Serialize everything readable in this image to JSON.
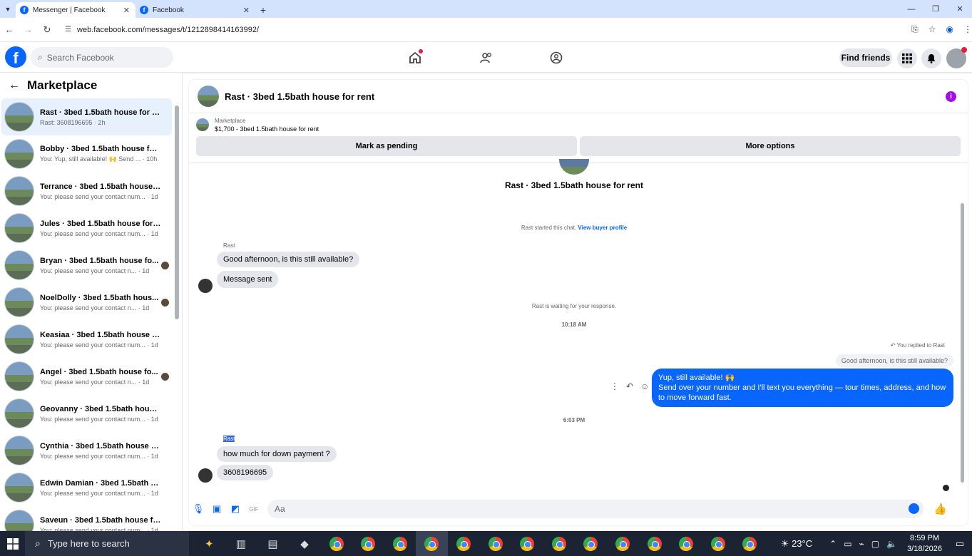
{
  "browser": {
    "tabs": [
      {
        "title": "Messenger | Facebook",
        "active": true
      },
      {
        "title": "Facebook",
        "active": false
      }
    ],
    "url": "web.facebook.com/messages/t/1212898414163992/"
  },
  "fb": {
    "search_placeholder": "Search Facebook",
    "find_friends": "Find friends"
  },
  "sidebar": {
    "title": "Marketplace",
    "conversations": [
      {
        "name": "Rast · 3bed 1.5bath house for rent",
        "preview": "Rast: 3608196695 · 2h",
        "active": true
      },
      {
        "name": "Bobby · 3bed 1.5bath house for ...",
        "preview": "You: Yup, still available! 🙌 Send ... · 10h"
      },
      {
        "name": "Terrance · 3bed 1.5bath house fo...",
        "preview": "You: please send your contact num... · 1d"
      },
      {
        "name": "Jules · 3bed 1.5bath house for rent",
        "preview": "You: please send your contact num... · 1d"
      },
      {
        "name": "Bryan · 3bed 1.5bath house fo...",
        "preview": "You: please send your contact n... · 1d"
      },
      {
        "name": "NoelDolly · 3bed 1.5bath hous...",
        "preview": "You: please send your contact n... · 1d"
      },
      {
        "name": "Keasiaa · 3bed 1.5bath house for...",
        "preview": "You: please send your contact num... · 1d"
      },
      {
        "name": "Angel · 3bed 1.5bath house fo...",
        "preview": "You: please send your contact n... · 1d"
      },
      {
        "name": "Geovanny · 3bed 1.5bath house ...",
        "preview": "You: please send your contact num... · 1d"
      },
      {
        "name": "Cynthia · 3bed 1.5bath house for...",
        "preview": "You: please send your contact num... · 1d"
      },
      {
        "name": "Edwin Damian · 3bed 1.5bath ho...",
        "preview": "You: please send your contact num... · 1d"
      },
      {
        "name": "Saveun · 3bed 1.5bath house for...",
        "preview": "You: please send your contact num... · 1d"
      }
    ]
  },
  "chat": {
    "title": "Rast · 3bed 1.5bath house for rent",
    "listing_label": "Marketplace",
    "listing_price": "$1,700 - 3bed 1.5bath house for rent",
    "mark_pending": "Mark as pending",
    "more_options": "More options",
    "profile_title": "Rast · 3bed 1.5bath house for rent",
    "started_text": "Rast started this chat.",
    "view_profile": "View buyer profile",
    "sender1": "Rast",
    "msg1": "Good afternoon, is this still available?",
    "msg2": "Message sent",
    "waiting": "Rast is waiting for your response.",
    "time1": "10:18 AM",
    "replied_to": "You replied to Rast",
    "quoted": "Good afternoon, is this still available?",
    "out_line1": "Yup, still available! 🙌",
    "out_line2": "Send over your number and I'll text you everything — tour times, address, and how to move forward fast.",
    "time2": "6:03 PM",
    "sender2": "Rast",
    "msg3": "how much for down payment ?",
    "msg4": "3608196695",
    "composer_placeholder": "Aa"
  },
  "taskbar": {
    "search_placeholder": "Type here to search",
    "temperature": "23°C",
    "time": "8:59 PM",
    "date": "3/18/2026"
  }
}
